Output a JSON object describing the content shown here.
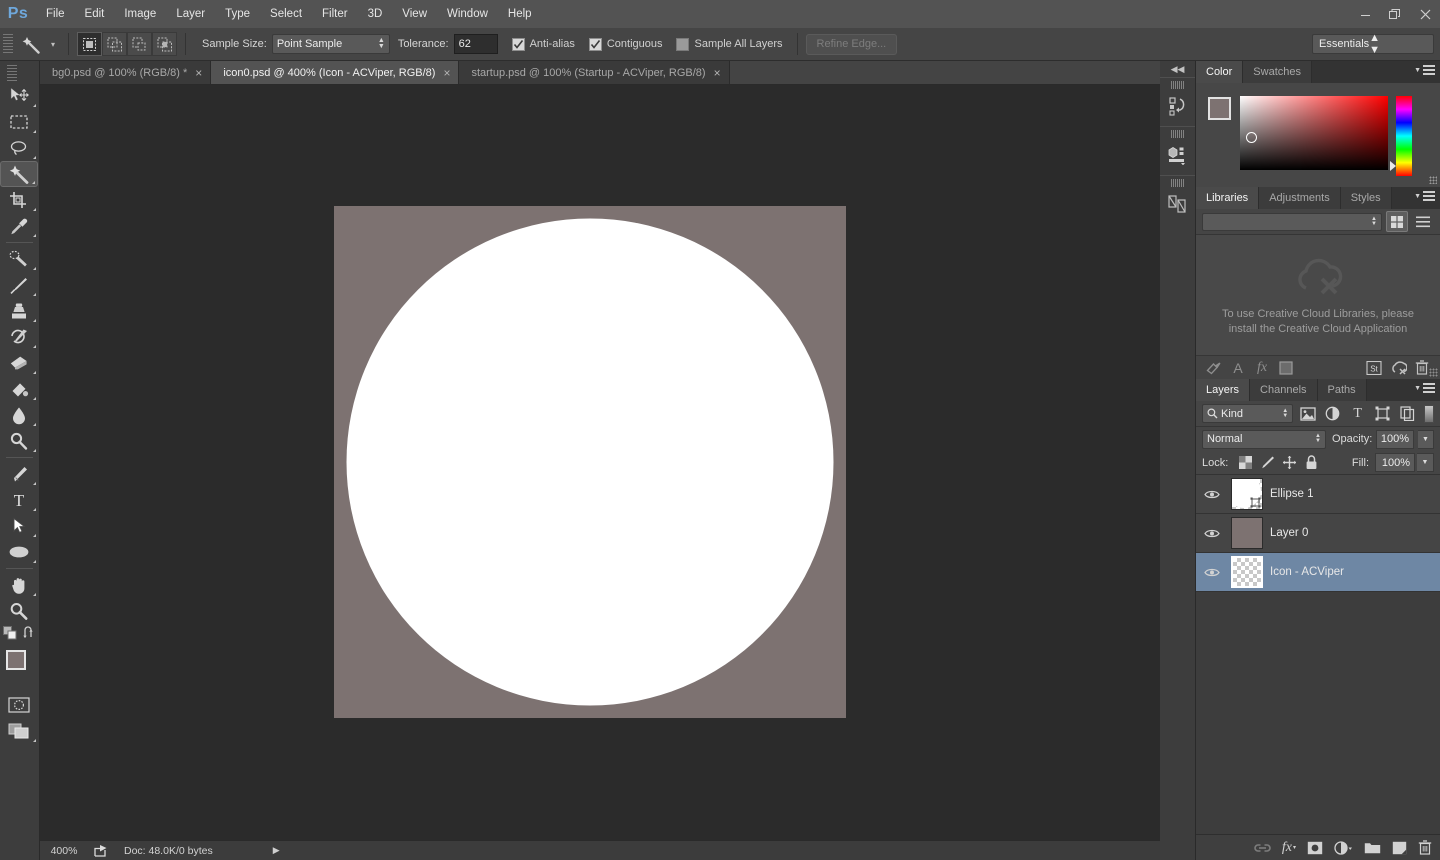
{
  "app": {
    "logo": "Ps",
    "menus": [
      "File",
      "Edit",
      "Image",
      "Layer",
      "Type",
      "Select",
      "Filter",
      "3D",
      "View",
      "Window",
      "Help"
    ],
    "window_controls": [
      "minimize",
      "restore",
      "close"
    ]
  },
  "options_bar": {
    "tool_icon": "magic-wand-icon",
    "selection_modes": [
      "new-selection",
      "add-to-selection",
      "subtract-from-selection",
      "intersect-with-selection"
    ],
    "active_mode_index": 0,
    "sample_size_label": "Sample Size:",
    "sample_size_value": "Point Sample",
    "tolerance_label": "Tolerance:",
    "tolerance_value": "62",
    "anti_alias_label": "Anti-alias",
    "anti_alias_checked": true,
    "contiguous_label": "Contiguous",
    "contiguous_checked": true,
    "sample_all_layers_label": "Sample All Layers",
    "sample_all_layers_checked": false,
    "refine_edge_label": "Refine Edge...",
    "refine_edge_enabled": false,
    "workspace_value": "Essentials"
  },
  "toolbar": {
    "tools": [
      {
        "name": "move-tool",
        "icon": "arrow-move-icon",
        "has_submenu": true
      },
      {
        "name": "rectangular-marquee-tool",
        "icon": "marquee-icon",
        "has_submenu": true
      },
      {
        "name": "lasso-tool",
        "icon": "lasso-icon",
        "has_submenu": true
      },
      {
        "name": "magic-wand-tool",
        "icon": "magic-wand-icon",
        "has_submenu": true,
        "active": true
      },
      {
        "name": "crop-tool",
        "icon": "crop-icon",
        "has_submenu": true
      },
      {
        "name": "eyedropper-tool",
        "icon": "eyedropper-icon",
        "has_submenu": true
      },
      {
        "name": "spot-healing-brush-tool",
        "icon": "healing-brush-icon",
        "has_submenu": true
      },
      {
        "name": "brush-tool",
        "icon": "brush-icon",
        "has_submenu": true
      },
      {
        "name": "clone-stamp-tool",
        "icon": "stamp-icon",
        "has_submenu": true
      },
      {
        "name": "history-brush-tool",
        "icon": "history-brush-icon",
        "has_submenu": true
      },
      {
        "name": "eraser-tool",
        "icon": "eraser-icon",
        "has_submenu": true
      },
      {
        "name": "gradient-tool",
        "icon": "paint-bucket-icon",
        "has_submenu": true
      },
      {
        "name": "blur-tool",
        "icon": "blur-drop-icon",
        "has_submenu": true
      },
      {
        "name": "dodge-tool",
        "icon": "dodge-icon",
        "has_submenu": true
      },
      {
        "name": "pen-tool",
        "icon": "pen-icon",
        "has_submenu": true
      },
      {
        "name": "type-tool",
        "icon": "type-t-icon",
        "has_submenu": true
      },
      {
        "name": "path-selection-tool",
        "icon": "path-arrow-icon",
        "has_submenu": true
      },
      {
        "name": "ellipse-tool",
        "icon": "ellipse-icon",
        "has_submenu": true
      },
      {
        "name": "hand-tool",
        "icon": "hand-icon",
        "has_submenu": true
      },
      {
        "name": "zoom-tool",
        "icon": "magnifier-icon",
        "has_submenu": false
      }
    ],
    "default_colors_icon": "default-colors-icon",
    "swap_colors_icon": "swap-colors-icon",
    "foreground_color": "#7d7271",
    "background_color": "#ffffff",
    "quick_mask_icon": "quick-mask-icon",
    "screen_mode_icon": "screen-mode-icon"
  },
  "tabs": [
    {
      "label": "bg0.psd @ 100% (RGB/8) *",
      "active": false,
      "close": "×"
    },
    {
      "label": "icon0.psd @ 400% (Icon - ACViper, RGB/8)",
      "active": true,
      "close": "×"
    },
    {
      "label": "startup.psd @ 100% (Startup - ACViper, RGB/8)",
      "active": false,
      "close": "×"
    }
  ],
  "canvas": {
    "artboard_color": "#7d7271",
    "shape_color": "#ffffff",
    "shape": "circle",
    "background_color": "#2b2b2b"
  },
  "status_bar": {
    "zoom": "400%",
    "share_icon": "share-icon",
    "doc_info": "Doc: 48.0K/0 bytes",
    "expand_icon": "triangle-right-icon"
  },
  "icon_rail": {
    "collapse_icon": "collapse-double-arrow-icon",
    "items": [
      {
        "name": "history-panel-icon",
        "icon": "history-icon"
      },
      {
        "name": "properties-panel-icon",
        "icon": "properties-icon"
      },
      {
        "name": "brushes-panel-icon",
        "icon": "brush-presets-icon"
      }
    ]
  },
  "color_panel": {
    "tabs": [
      {
        "label": "Color",
        "active": true
      },
      {
        "label": "Swatches",
        "active": false
      }
    ],
    "menu_icon": "panel-menu-icon",
    "foreground_color": "#7d7271",
    "background_color": "#ffffff"
  },
  "libraries_panel": {
    "tabs": [
      {
        "label": "Libraries",
        "active": true
      },
      {
        "label": "Adjustments",
        "active": false
      },
      {
        "label": "Styles",
        "active": false
      }
    ],
    "menu_icon": "panel-menu-icon",
    "search_value": "",
    "view_grid_icon": "grid-view-icon",
    "view_list_icon": "list-view-icon",
    "active_view": "grid",
    "cloud_icon": "creative-cloud-off-icon",
    "message": "To use Creative Cloud Libraries, please install the Creative Cloud Application",
    "footer_icons": [
      {
        "name": "add-graphic-icon"
      },
      {
        "name": "add-text-style-icon"
      },
      {
        "name": "add-layer-style-icon"
      },
      {
        "name": "add-color-icon"
      },
      {
        "name": "add-stock-icon",
        "label": "St"
      },
      {
        "name": "sync-off-icon"
      },
      {
        "name": "delete-icon"
      }
    ]
  },
  "layers_panel": {
    "tabs": [
      {
        "label": "Layers",
        "active": true
      },
      {
        "label": "Channels",
        "active": false
      },
      {
        "label": "Paths",
        "active": false
      }
    ],
    "menu_icon": "panel-menu-icon",
    "filter_kind_label": "Kind",
    "filter_icons": [
      {
        "name": "filter-pixel-icon"
      },
      {
        "name": "filter-adjustment-icon"
      },
      {
        "name": "filter-type-icon"
      },
      {
        "name": "filter-shape-icon"
      },
      {
        "name": "filter-smart-object-icon"
      }
    ],
    "blend_mode": "Normal",
    "opacity_label": "Opacity:",
    "opacity_value": "100%",
    "lock_label": "Lock:",
    "lock_icons": [
      {
        "name": "lock-transparent-pixels-icon"
      },
      {
        "name": "lock-image-pixels-icon"
      },
      {
        "name": "lock-position-icon"
      },
      {
        "name": "lock-all-icon"
      }
    ],
    "fill_label": "Fill:",
    "fill_value": "100%",
    "layers": [
      {
        "name": "Ellipse 1",
        "visible": true,
        "selected": false,
        "thumb": "circle-vector",
        "color": "#ffffff"
      },
      {
        "name": "Layer 0",
        "visible": true,
        "selected": false,
        "thumb": "solid",
        "color": "#7d7271"
      },
      {
        "name": "Icon - ACViper",
        "visible": true,
        "selected": true,
        "thumb": "transparent",
        "color": "transparent"
      }
    ],
    "footer_icons": [
      {
        "name": "link-layers-icon",
        "enabled": false
      },
      {
        "name": "add-layer-style-icon",
        "enabled": true
      },
      {
        "name": "add-layer-mask-icon",
        "enabled": true
      },
      {
        "name": "new-adjustment-layer-icon",
        "enabled": true
      },
      {
        "name": "new-group-icon",
        "enabled": true
      },
      {
        "name": "new-layer-icon",
        "enabled": true
      },
      {
        "name": "delete-layer-icon",
        "enabled": true
      }
    ]
  }
}
